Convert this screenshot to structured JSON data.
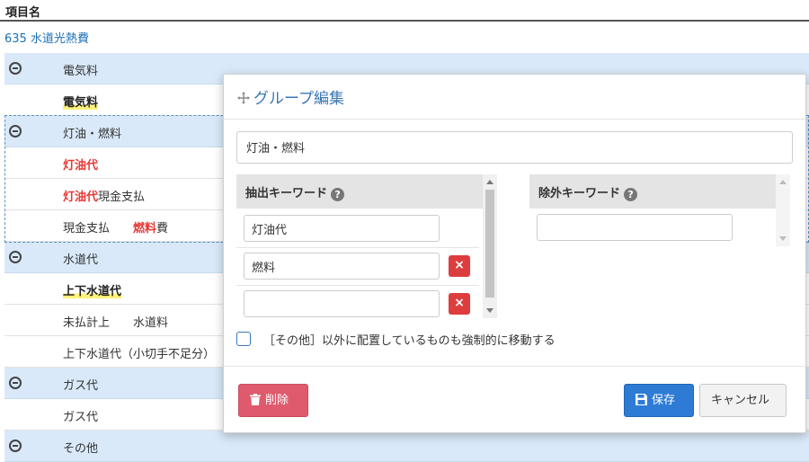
{
  "list": {
    "column_header": "項目名",
    "account": "635 水道光熱費",
    "groups": [
      {
        "label": "電気料",
        "rows": [
          [
            {
              "t": "電気料",
              "s": "yellow"
            }
          ]
        ]
      },
      {
        "label": "灯油・燃料",
        "rows": [
          [
            {
              "t": "灯油代",
              "s": "red"
            }
          ],
          [
            {
              "t": "灯油代",
              "s": "red"
            },
            {
              "t": "現金支払",
              "s": ""
            }
          ],
          [
            {
              "t": "現金支払　　",
              "s": ""
            },
            {
              "t": "燃料",
              "s": "red"
            },
            {
              "t": "費",
              "s": ""
            }
          ]
        ]
      },
      {
        "label": "水道代",
        "rows": [
          [
            {
              "t": "上下水道代",
              "s": "yellow"
            }
          ],
          [
            {
              "t": "未払計上　　水道料",
              "s": ""
            }
          ],
          [
            {
              "t": "上下水道代（小切手不足分）",
              "s": ""
            }
          ]
        ]
      },
      {
        "label": "ガス代",
        "rows": [
          [
            {
              "t": "ガス代",
              "s": ""
            }
          ]
        ]
      },
      {
        "label": "その他",
        "rows": []
      }
    ]
  },
  "modal": {
    "title": "グループ編集",
    "group_name": "灯油・燃料",
    "extract": {
      "header": "抽出キーワード",
      "keywords": [
        "灯油代",
        "燃料",
        ""
      ],
      "delete_symbol": "×"
    },
    "exclude": {
      "header": "除外キーワード",
      "keywords": [
        ""
      ]
    },
    "help_symbol": "?",
    "force_move_label": "［その他］以外に配置しているものも強制的に移動する",
    "force_move_checked": false,
    "delete_label": "削除",
    "save_label": "保存",
    "cancel_label": "キャンセル"
  },
  "colors": {
    "accent": "#2d7bd5",
    "danger": "#e05a6d",
    "group_bg": "#d9e9f9",
    "highlight_red": "#e53935",
    "highlight_yellow": "#fff27a"
  }
}
